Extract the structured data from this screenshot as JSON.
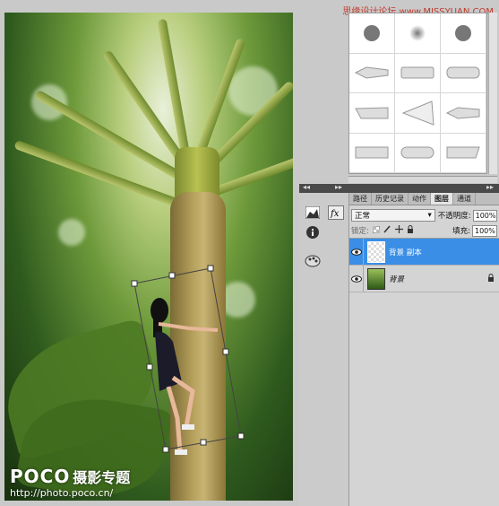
{
  "credit": {
    "site": "思缘设计论坛",
    "sep": "  ",
    "domain": "www.MISSYUAN.COM"
  },
  "watermark": {
    "logo": "POCO",
    "logo_sub": "摄影专题",
    "url": "http://photo.poco.cn/"
  },
  "brushes": {
    "items": [
      "hard-round-brush",
      "soft-round-brush",
      "hard-round-brush",
      "flat-point-brush",
      "flat-blunt-brush",
      "round-blunt-brush",
      "flat-angle-brush",
      "fan-brush",
      "round-point-brush",
      "flat-blunt-brush",
      "round-curve-brush",
      "angle-brush"
    ]
  },
  "dock": {
    "collapse": "◂◂",
    "expand": "▸▸"
  },
  "layers_panel": {
    "header_collapse": "▸▸",
    "tabs": [
      "路径",
      "历史记录",
      "动作",
      "图层",
      "通道"
    ],
    "active_tab": 3,
    "blend_mode": "正常",
    "opacity_label": "不透明度:",
    "opacity_value": "100%",
    "lock_label": "锁定:",
    "fill_label": "填充:",
    "fill_value": "100%",
    "layers": [
      {
        "name": "背景 副本",
        "selected": true,
        "locked": false
      },
      {
        "name": "背景",
        "selected": false,
        "locked": true
      }
    ]
  },
  "colors": {
    "selection": "#3a8ee6",
    "panel": "#d4d4d4"
  }
}
